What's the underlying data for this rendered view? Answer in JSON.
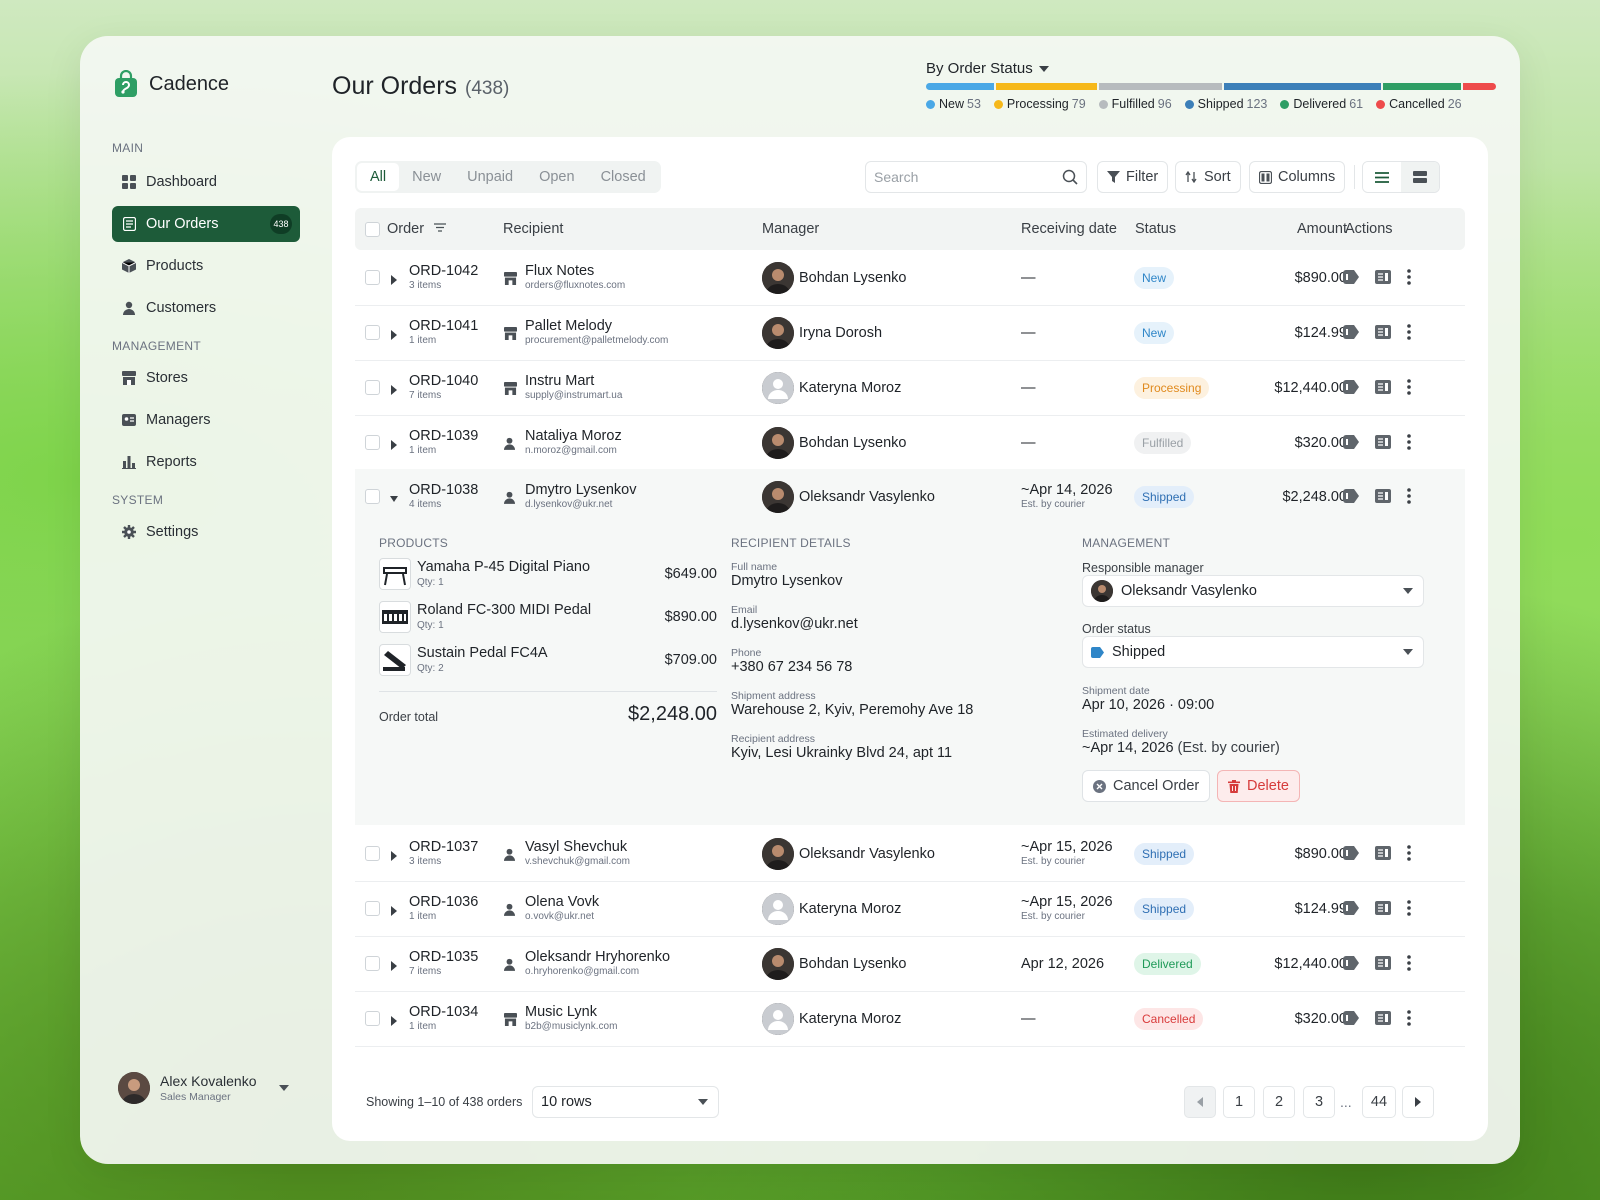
{
  "app": {
    "name": "Cadence"
  },
  "sidebar": {
    "sections": [
      {
        "label": "MAIN"
      },
      {
        "label": "MANAGEMENT"
      },
      {
        "label": "SYSTEM"
      }
    ],
    "items": [
      {
        "label": "Dashboard",
        "icon": "dashboard-icon"
      },
      {
        "label": "Our Orders",
        "icon": "orders-icon",
        "count": "438",
        "active": true
      },
      {
        "label": "Products",
        "icon": "box-icon"
      },
      {
        "label": "Customers",
        "icon": "person-icon"
      },
      {
        "label": "Stores",
        "icon": "store-icon"
      },
      {
        "label": "Managers",
        "icon": "id-card-icon"
      },
      {
        "label": "Reports",
        "icon": "bar-chart-icon"
      },
      {
        "label": "Settings",
        "icon": "gear-icon"
      }
    ],
    "user": {
      "name": "Alex Kovalenko",
      "role": "Sales Manager"
    }
  },
  "header": {
    "title": "Our Orders",
    "count": "(438)"
  },
  "status_summary": {
    "title": "By Order Status",
    "items": [
      {
        "label": "New",
        "value": 53,
        "color": "#4aa8e6"
      },
      {
        "label": "Processing",
        "value": 79,
        "color": "#f6b81a"
      },
      {
        "label": "Fulfilled",
        "value": 96,
        "color": "#b7bbbe"
      },
      {
        "label": "Shipped",
        "value": 123,
        "color": "#3c7fb8"
      },
      {
        "label": "Delivered",
        "value": 61,
        "color": "#2e9e64"
      },
      {
        "label": "Cancelled",
        "value": 26,
        "color": "#ee4b4b"
      }
    ]
  },
  "toolbar": {
    "tabs": [
      "All",
      "New",
      "Unpaid",
      "Open",
      "Closed"
    ],
    "search_placeholder": "Search",
    "filter": "Filter",
    "sort": "Sort",
    "columns": "Columns"
  },
  "table": {
    "headers": {
      "order": "Order",
      "recipient": "Recipient",
      "manager": "Manager",
      "date": "Receiving date",
      "status": "Status",
      "amount": "Amount",
      "actions": "Actions"
    },
    "rows": [
      {
        "id": "ORD-1042",
        "items": "3 items",
        "recipient": "Flux Notes",
        "email": "orders@fluxnotes.com",
        "rtype": "store",
        "manager": "Bohdan Lysenko",
        "avatar": "photo",
        "date": "—",
        "date_sub": "",
        "status": "New",
        "amount": "$890.00"
      },
      {
        "id": "ORD-1041",
        "items": "1 item",
        "recipient": "Pallet Melody",
        "email": "procurement@palletmelody.com",
        "rtype": "store",
        "manager": "Iryna Dorosh",
        "avatar": "photo",
        "date": "—",
        "date_sub": "",
        "status": "New",
        "amount": "$124.99"
      },
      {
        "id": "ORD-1040",
        "items": "7 items",
        "recipient": "Instru Mart",
        "email": "supply@instrumart.ua",
        "rtype": "store",
        "manager": "Kateryna Moroz",
        "avatar": "placeholder",
        "date": "—",
        "date_sub": "",
        "status": "Processing",
        "amount": "$12,440.00"
      },
      {
        "id": "ORD-1039",
        "items": "1 item",
        "recipient": "Nataliya Moroz",
        "email": "n.moroz@gmail.com",
        "rtype": "person",
        "manager": "Bohdan Lysenko",
        "avatar": "photo",
        "date": "—",
        "date_sub": "",
        "status": "Fulfilled",
        "amount": "$320.00"
      },
      {
        "id": "ORD-1038",
        "items": "4 items",
        "recipient": "Dmytro Lysenkov",
        "email": "d.lysenkov@ukr.net",
        "rtype": "person",
        "manager": "Oleksandr Vasylenko",
        "avatar": "photo",
        "date": "~Apr 14, 2026",
        "date_sub": "Est. by courier",
        "status": "Shipped",
        "amount": "$2,248.00"
      },
      {
        "id": "ORD-1037",
        "items": "3 items",
        "recipient": "Vasyl Shevchuk",
        "email": "v.shevchuk@gmail.com",
        "rtype": "person",
        "manager": "Oleksandr Vasylenko",
        "avatar": "photo",
        "date": "~Apr 15, 2026",
        "date_sub": "Est. by courier",
        "status": "Shipped",
        "amount": "$890.00"
      },
      {
        "id": "ORD-1036",
        "items": "1 item",
        "recipient": "Olena Vovk",
        "email": "o.vovk@ukr.net",
        "rtype": "person",
        "manager": "Kateryna Moroz",
        "avatar": "placeholder",
        "date": "~Apr 15, 2026",
        "date_sub": "Est. by courier",
        "status": "Shipped",
        "amount": "$124.99"
      },
      {
        "id": "ORD-1035",
        "items": "7 items",
        "recipient": "Oleksandr Hryhorenko",
        "email": "o.hryhorenko@gmail.com",
        "rtype": "person",
        "manager": "Bohdan Lysenko",
        "avatar": "photo",
        "date": "Apr 12, 2026",
        "date_sub": "",
        "status": "Delivered",
        "amount": "$12,440.00"
      },
      {
        "id": "ORD-1034",
        "items": "1 item",
        "recipient": "Music Lynk",
        "email": "b2b@musiclynk.com",
        "rtype": "store",
        "manager": "Kateryna Moroz",
        "avatar": "placeholder",
        "date": "—",
        "date_sub": "",
        "status": "Cancelled",
        "amount": "$320.00"
      }
    ]
  },
  "expanded": {
    "products_title": "PRODUCTS",
    "products": [
      {
        "name": "Yamaha P-45 Digital Piano",
        "qty": "Qty: 1",
        "price": "$649.00"
      },
      {
        "name": "Roland FC-300 MIDI Pedal",
        "qty": "Qty: 1",
        "price": "$890.00"
      },
      {
        "name": "Sustain Pedal FC4A",
        "qty": "Qty: 2",
        "price": "$709.00"
      }
    ],
    "total_label": "Order total",
    "total": "$2,248.00",
    "recipient_title": "RECIPIENT DETAILS",
    "fields": [
      {
        "label": "Full name",
        "value": "Dmytro Lysenkov"
      },
      {
        "label": "Email",
        "value": "d.lysenkov@ukr.net"
      },
      {
        "label": "Phone",
        "value": "+380 67 234 56 78"
      },
      {
        "label": "Shipment address",
        "value": "Warehouse 2, Kyiv, Peremohy Ave 18"
      },
      {
        "label": "Recipient address",
        "value": "Kyiv, Lesi Ukrainky Blvd 24, apt 11"
      }
    ],
    "management_title": "MANAGEMENT",
    "manager_label": "Responsible manager",
    "manager_value": "Oleksandr Vasylenko",
    "status_label": "Order status",
    "status_value": "Shipped",
    "shipment_date_label": "Shipment date",
    "shipment_date": "Apr 10, 2026 · 09:00",
    "est_label": "Estimated delivery",
    "est_value": "~Apr 14, 2026",
    "est_note": "(Est. by courier)",
    "cancel_label": "Cancel Order",
    "delete_label": "Delete"
  },
  "footer": {
    "showing": "Showing 1–10 of 438 orders",
    "rows_value": "10 rows",
    "pages": [
      "1",
      "2",
      "3",
      "44"
    ],
    "ellipsis": "..."
  },
  "colors": {
    "accent": "#1d5b39",
    "status": {
      "New": {
        "bg": "#e6f2fb",
        "fg": "#2f86c8"
      },
      "Processing": {
        "bg": "#fdf1df",
        "fg": "#e08a1e"
      },
      "Fulfilled": {
        "bg": "#f0f1f2",
        "fg": "#9aa0a6"
      },
      "Shipped": {
        "bg": "#e3eefa",
        "fg": "#2f6fb3"
      },
      "Delivered": {
        "bg": "#dff5e8",
        "fg": "#1f9a58"
      },
      "Cancelled": {
        "bg": "#fde6e6",
        "fg": "#d93b3b"
      }
    }
  }
}
